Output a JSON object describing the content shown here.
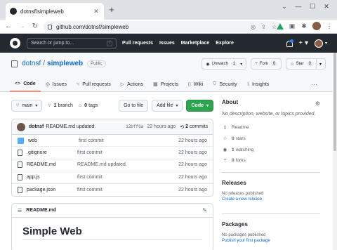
{
  "browser": {
    "tab_title": "dotnsf/simpleweb",
    "tab_close": "✕",
    "new_tab": "+",
    "url": "github.com/dotnsf/simpleweb",
    "window_controls": {
      "minimize": "—",
      "maximize": "☐",
      "close": "✕"
    }
  },
  "github": {
    "search_placeholder": "Search or jump to...",
    "search_shortcut": "/",
    "nav": [
      "Pull requests",
      "Issues",
      "Marketplace",
      "Explore"
    ]
  },
  "repo": {
    "owner": "dotnsf",
    "separator": "/",
    "name": "simpleweb",
    "visibility": "Public",
    "unwatch_label": "Unwatch",
    "unwatch_count": "1",
    "fork_label": "Fork",
    "fork_count": "0",
    "star_label": "Star",
    "star_count": "0",
    "tabs": [
      {
        "label": "Code",
        "icon": "<>"
      },
      {
        "label": "Issues",
        "icon": "◎"
      },
      {
        "label": "Pull requests",
        "icon": "⑂"
      },
      {
        "label": "Actions",
        "icon": "▷"
      },
      {
        "label": "Projects",
        "icon": "▦"
      },
      {
        "label": "Wiki",
        "icon": "▯"
      },
      {
        "label": "Security",
        "icon": "⛉"
      },
      {
        "label": "Insights",
        "icon": "⌇"
      }
    ],
    "more_tabs": "···"
  },
  "toolbar": {
    "branch_label": "main",
    "branch_count": "1",
    "branch_word": "branch",
    "tag_count": "0",
    "tag_word": "tags",
    "goto_file": "Go to file",
    "add_file": "Add file",
    "code": "Code"
  },
  "commit": {
    "user": "dotnsf",
    "message": "README.md updated.",
    "sha": "12bff6a",
    "time": "22 hours ago",
    "count": "2",
    "count_word": "commits"
  },
  "files": [
    {
      "name": "web",
      "type": "folder",
      "message": "first commit",
      "age": "22 hours ago"
    },
    {
      "name": ".gitignore",
      "type": "file",
      "message": "first commit",
      "age": "22 hours ago"
    },
    {
      "name": "README.md",
      "type": "file",
      "message": "README.md updated.",
      "age": "22 hours ago"
    },
    {
      "name": "app.js",
      "type": "file",
      "message": "first commit",
      "age": "22 hours ago"
    },
    {
      "name": "package.json",
      "type": "file",
      "message": "first commit",
      "age": "22 hours ago"
    }
  ],
  "readme": {
    "filename": "README.md",
    "heading": "Simple Web"
  },
  "about": {
    "title": "About",
    "description": "No description, website, or topics provided.",
    "readme_label": "Readme",
    "stars_count": "0",
    "stars_word": "stars",
    "watching_count": "1",
    "watching_word": "watching",
    "forks_count": "0",
    "forks_word": "forks"
  },
  "releases": {
    "title": "Releases",
    "empty": "No releases published",
    "link": "Create a new release"
  },
  "packages": {
    "title": "Packages",
    "empty": "No packages published",
    "link": "Publish your first package"
  },
  "colors": {
    "accent_blue": "#0969da",
    "header_dark": "#24292f",
    "code_button_green": "#2da44e",
    "active_tab_underline": "#fd8c73"
  }
}
